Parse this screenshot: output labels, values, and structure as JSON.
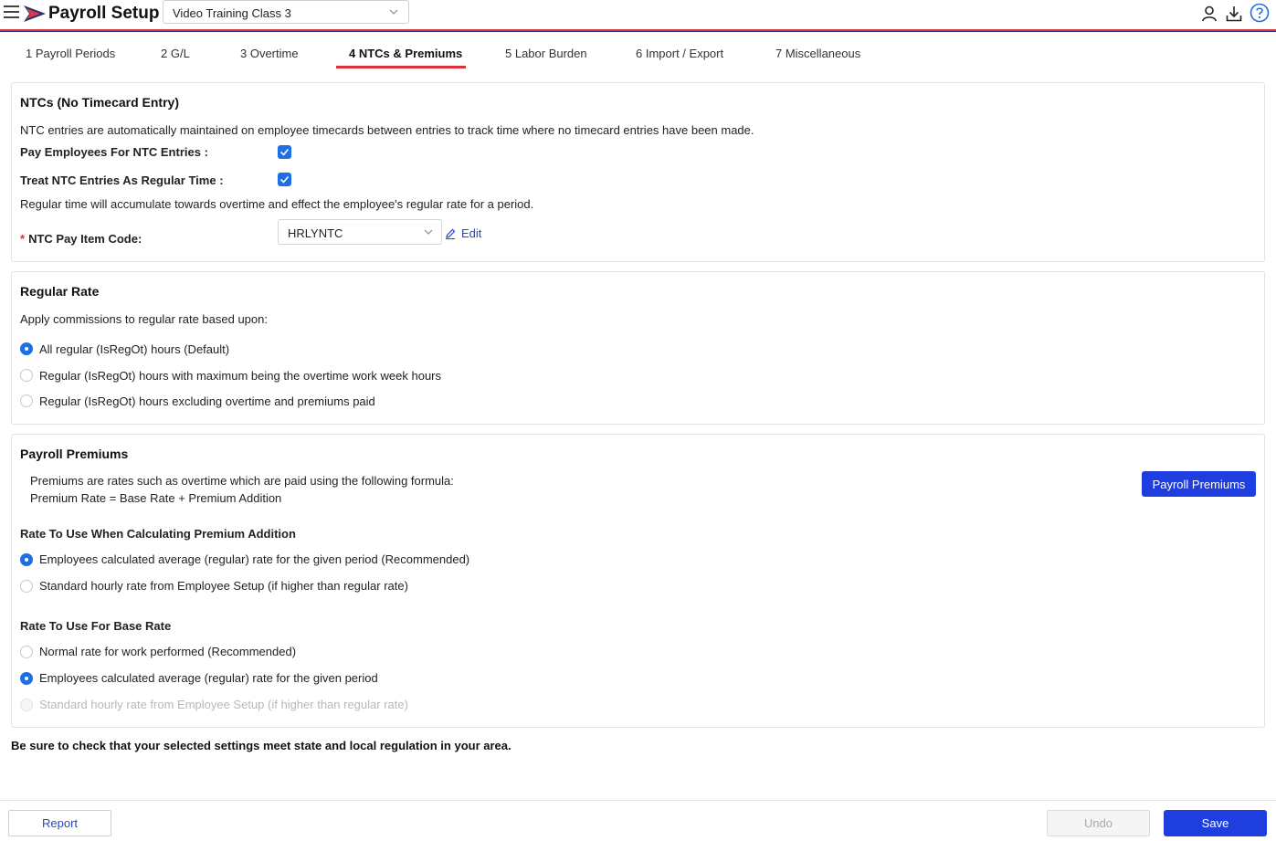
{
  "header": {
    "title": "Payroll Setup",
    "company": "Video Training Class 3",
    "icons": [
      "menu-icon",
      "user-icon",
      "download-icon",
      "help-icon"
    ]
  },
  "tabs": [
    {
      "label": "1 Payroll Periods"
    },
    {
      "label": "2 G/L"
    },
    {
      "label": "3 Overtime"
    },
    {
      "label": "4 NTCs & Premiums",
      "active": true
    },
    {
      "label": "5 Labor Burden"
    },
    {
      "label": "6 Import / Export"
    },
    {
      "label": "7 Miscellaneous"
    }
  ],
  "ntc": {
    "title": "NTCs (No Timecard Entry)",
    "description": "NTC entries are automatically maintained on employee timecards between entries to track time where no timecard entries have been made.",
    "pay_label": "Pay Employees For NTC Entries",
    "pay_checked": true,
    "regular_label": "Treat NTC Entries As Regular Time",
    "regular_checked": true,
    "regular_note": "Regular time will accumulate towards overtime and effect the employee's regular rate for a period.",
    "required_mark": "*",
    "colon": ":",
    "pay_item_label": "NTC Pay Item Code",
    "pay_item_value": "HRLYNTC",
    "edit_label": "Edit"
  },
  "regular_rate": {
    "title": "Regular Rate",
    "description": "Apply commissions to regular rate based upon:",
    "options": [
      {
        "label": "All regular (IsRegOt) hours (Default)",
        "selected": true
      },
      {
        "label": "Regular (IsRegOt) hours with maximum being the overtime work week hours",
        "selected": false
      },
      {
        "label": "Regular (IsRegOt) hours excluding overtime and premiums paid",
        "selected": false
      }
    ]
  },
  "premiums": {
    "title": "Payroll Premiums",
    "description_line1": "Premiums are rates such as overtime which are paid using the following formula:",
    "description_line2": "Premium Rate = Base Rate + Premium Addition",
    "button_label": "Payroll Premiums",
    "addition_title": "Rate To Use When Calculating Premium Addition",
    "addition_options": [
      {
        "label": "Employees calculated average (regular) rate for the given period (Recommended)",
        "selected": true
      },
      {
        "label": "Standard hourly rate from Employee Setup (if higher than regular rate)",
        "selected": false
      }
    ],
    "base_title": "Rate To Use For Base Rate",
    "base_options": [
      {
        "label": "Normal rate for work performed (Recommended)",
        "selected": false
      },
      {
        "label": "Employees calculated average (regular) rate for the given period",
        "selected": true
      },
      {
        "label": "Standard hourly rate from Employee Setup (if higher than regular rate)",
        "selected": false,
        "disabled": true
      }
    ]
  },
  "warning": "Be sure to check that your selected settings meet state and local regulation in your area.",
  "footer": {
    "report_label": "Report",
    "undo_label": "Undo",
    "save_label": "Save"
  },
  "colors": {
    "accent": "#1f3ee0",
    "tab_underline": "#e0303b",
    "checkbox": "#1e6ee8"
  }
}
